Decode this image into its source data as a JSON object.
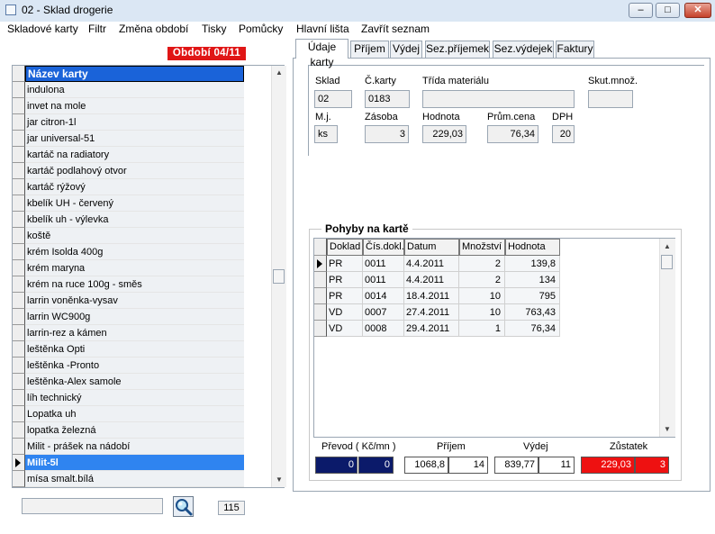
{
  "window": {
    "title": "02 - Sklad drogerie",
    "minimize_glyph": "–",
    "maximize_glyph": "□",
    "close_glyph": "✕"
  },
  "menu": [
    "Skladové karty",
    "Filtr",
    "Změna období",
    "Tisky",
    "Pomůcky",
    "Hlavní lišta",
    "Zavřít seznam"
  ],
  "period_label": "Období 04/11",
  "card_list": {
    "header": "Název karty",
    "items": [
      "indulona",
      "invet na mole",
      "jar citron-1l",
      "jar universal-51",
      "kartáč na radiatory",
      "kartáč podlahový otvor",
      "kartáč rýžový",
      "kbelík UH - červený",
      "kbelík uh - výlevka",
      "koště",
      "krém Isolda 400g",
      "krém maryna",
      "krém na ruce 100g - směs",
      "larrin voněnka-vysav",
      "larrin WC900g",
      "larrin-rez a kámen",
      "leštěnka Opti",
      "leštěnka -Pronto",
      "leštěnka-Alex samole",
      "líh technický",
      "Lopatka uh",
      "lopatka železná",
      "Milit - prášek na nádobí",
      "Milit-5l",
      "mísa smalt.bílá"
    ],
    "selected_index": 23,
    "scroll_up": "▲",
    "scroll_down": "▼"
  },
  "search": {
    "value": "",
    "icon": "magnifier-icon",
    "count": "115"
  },
  "tabs": [
    "Údaje karty",
    "Příjem",
    "Výdej",
    "Sez.příjemek",
    "Sez.výdejek",
    "Faktury"
  ],
  "active_tab": 0,
  "card_detail": {
    "labels": {
      "sklad": "Sklad",
      "cislo_karty": "Č.karty",
      "trida": "Třída materiálu",
      "skut_mnoz": "Skut.množ.",
      "mj": "M.j.",
      "zasoba": "Zásoba",
      "hodnota": "Hodnota",
      "prum_cena": "Prům.cena",
      "dph": "DPH"
    },
    "values": {
      "sklad": "02",
      "cislo_karty": "0183",
      "trida": "",
      "skut_mnoz": "",
      "mj": "ks",
      "zasoba": "3",
      "hodnota": "229,03",
      "prum_cena": "76,34",
      "dph": "20"
    }
  },
  "movements": {
    "title": "Pohyby na kartě",
    "columns": [
      "Doklad",
      "Čís.dokl.",
      "Datum",
      "Množství",
      "Hodnota"
    ],
    "rows": [
      [
        "PR",
        "0011",
        "4.4.2011",
        "2",
        "139,8"
      ],
      [
        "PR",
        "0011",
        "4.4.2011",
        "2",
        "134"
      ],
      [
        "PR",
        "0014",
        "18.4.2011",
        "10",
        "795"
      ],
      [
        "VD",
        "0007",
        "27.4.2011",
        "10",
        "763,43"
      ],
      [
        "VD",
        "0008",
        "29.4.2011",
        "1",
        "76,34"
      ]
    ],
    "selected_row": 0,
    "scroll_up": "▲",
    "scroll_down": "▼"
  },
  "totals": {
    "labels": {
      "prevod": "Převod ( Kč/mn )",
      "prijem": "Příjem",
      "vydej": "Výdej",
      "zustatek": "Zůstatek"
    },
    "prevod": {
      "value": "0",
      "qty": "0"
    },
    "prijem": {
      "value": "1068,8",
      "qty": "14"
    },
    "vydej": {
      "value": "839,77",
      "qty": "11"
    },
    "zustatek": {
      "value": "229,03",
      "qty": "3"
    }
  },
  "colors": {
    "selection": "#2f84f0",
    "header": "#1a63d9",
    "period": "#e01616",
    "navy": "#0b1a6a",
    "red": "#ee1111"
  }
}
